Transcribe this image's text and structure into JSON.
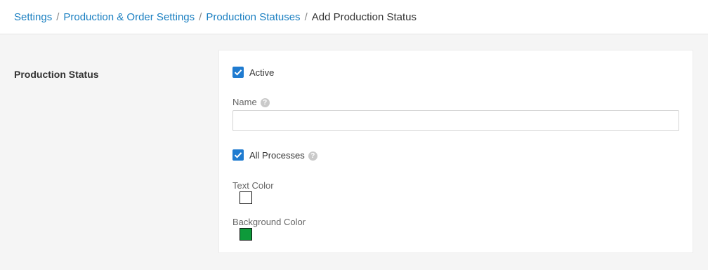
{
  "breadcrumb": {
    "items": [
      "Settings",
      "Production & Order Settings",
      "Production Statuses"
    ],
    "separator": "/",
    "current": "Add Production Status"
  },
  "section": {
    "label": "Production Status"
  },
  "form": {
    "active": {
      "label": "Active",
      "checked": true
    },
    "name": {
      "label": "Name",
      "value": "",
      "placeholder": ""
    },
    "all_processes": {
      "label": "All Processes",
      "checked": true
    },
    "text_color": {
      "label": "Text Color",
      "value": "#ffffff"
    },
    "background_color": {
      "label": "Background Color",
      "value": "#0d9a3a"
    }
  },
  "icons": {
    "help": "?"
  },
  "colors": {
    "link": "#1a7fc1",
    "accent": "#1f7bd0"
  }
}
